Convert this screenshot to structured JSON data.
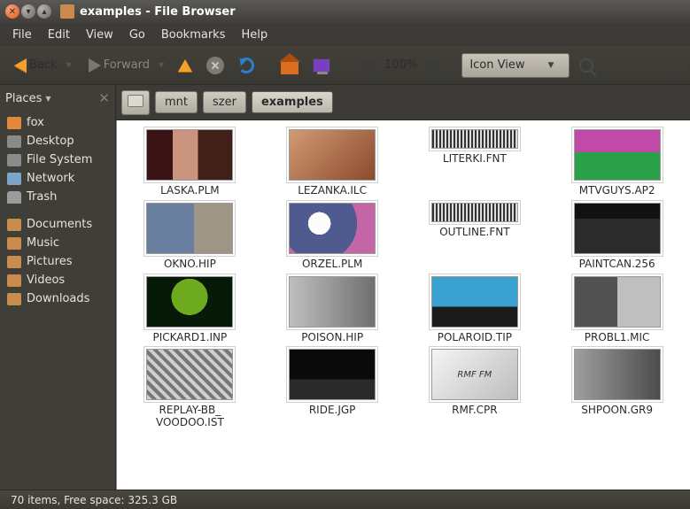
{
  "window": {
    "title": "examples - File Browser"
  },
  "menu": {
    "file": "File",
    "edit": "Edit",
    "view": "View",
    "go": "Go",
    "bookmarks": "Bookmarks",
    "help": "Help"
  },
  "toolbar": {
    "back": "Back",
    "forward": "Forward",
    "zoom": "100%",
    "view_mode": "Icon View"
  },
  "sidebar": {
    "header": "Places",
    "items": [
      {
        "label": "fox",
        "kind": "home"
      },
      {
        "label": "Desktop",
        "kind": "disk"
      },
      {
        "label": "File System",
        "kind": "disk"
      },
      {
        "label": "Network",
        "kind": "net"
      },
      {
        "label": "Trash",
        "kind": "trash"
      }
    ],
    "bookmarks": [
      {
        "label": "Documents"
      },
      {
        "label": "Music"
      },
      {
        "label": "Pictures"
      },
      {
        "label": "Videos"
      },
      {
        "label": "Downloads"
      }
    ]
  },
  "path": {
    "segments": [
      {
        "label": "",
        "icon": true
      },
      {
        "label": "mnt"
      },
      {
        "label": "szer"
      },
      {
        "label": "examples",
        "active": true
      }
    ]
  },
  "files": [
    {
      "name": "LASKA.PLM",
      "t": "t1"
    },
    {
      "name": "LEZANKA.ILC",
      "t": "t2"
    },
    {
      "name": "LITERKI.FNT",
      "t": "fnt"
    },
    {
      "name": "MTVGUYS.AP2",
      "t": "t3"
    },
    {
      "name": "OKNO.HIP",
      "t": "t4"
    },
    {
      "name": "ORZEL.PLM",
      "t": "t5"
    },
    {
      "name": "OUTLINE.FNT",
      "t": "fnt"
    },
    {
      "name": "PAINTCAN.256",
      "t": "paint"
    },
    {
      "name": "PICKARD1.INP",
      "t": "t7"
    },
    {
      "name": "POISON.HIP",
      "t": "t8"
    },
    {
      "name": "POLAROID.TIP",
      "t": "t9"
    },
    {
      "name": "PROBL1.MIC",
      "t": "t10"
    },
    {
      "name": "REPLAY-BB_\nVOODOO.IST",
      "t": "t11"
    },
    {
      "name": "RIDE.JGP",
      "t": "t12"
    },
    {
      "name": "RMF.CPR",
      "t": "t13",
      "inner": "RMF FM"
    },
    {
      "name": "SHPOON.GR9",
      "t": "t14"
    }
  ],
  "status": {
    "text": "70 items, Free space: 325.3 GB"
  }
}
